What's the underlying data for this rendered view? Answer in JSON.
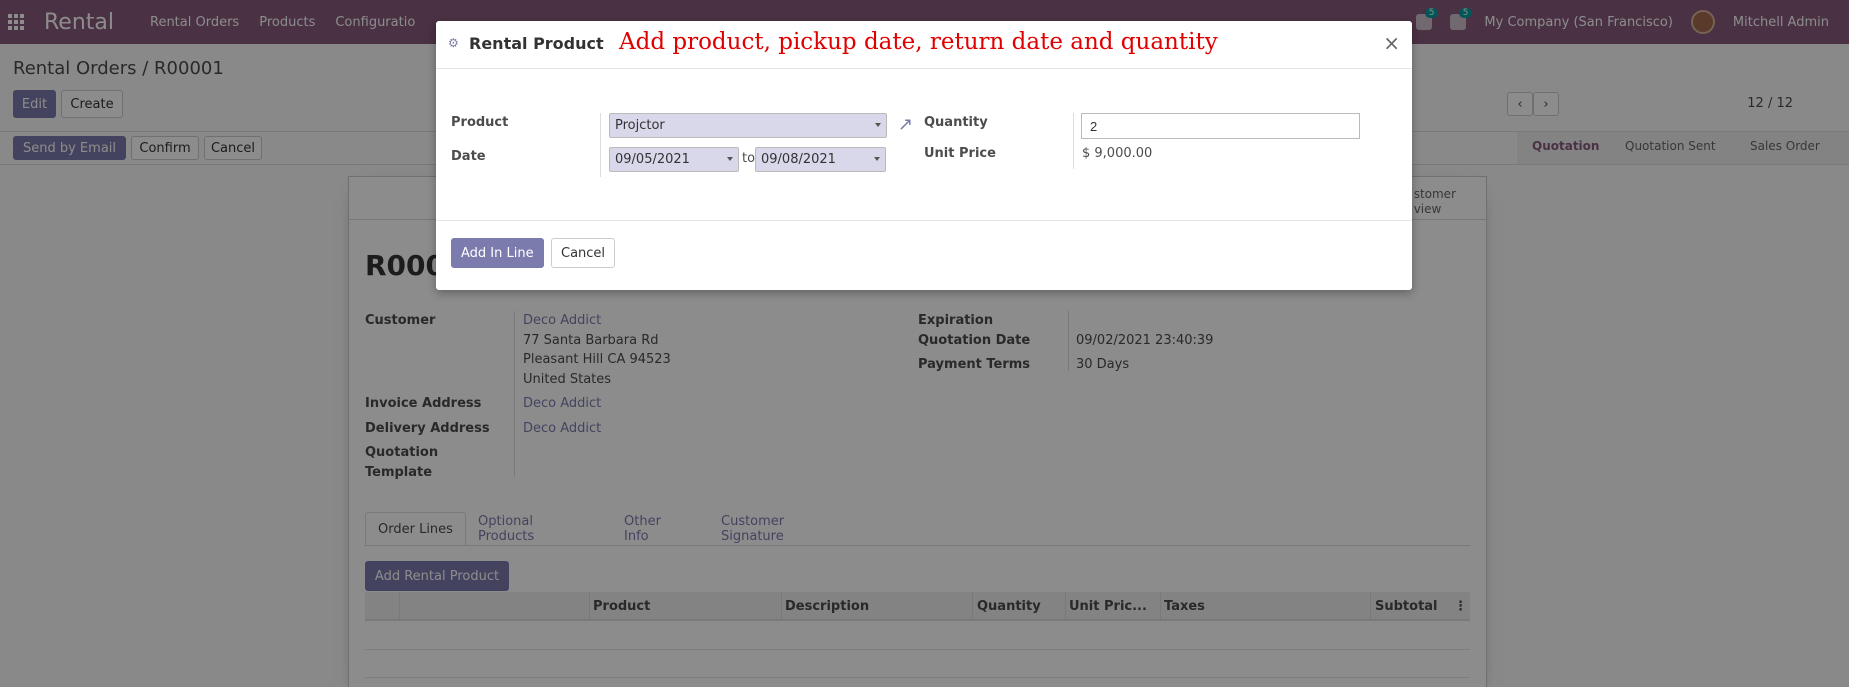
{
  "app": {
    "brand": "Rental"
  },
  "topnav": {
    "menus": [
      "Rental Orders",
      "Products",
      "Configuratio"
    ],
    "activity_count": "5",
    "message_count": "5",
    "company": "My Company (San Francisco)",
    "user": "Mitchell Admin"
  },
  "control": {
    "breadcrumb": "Rental Orders / R00001",
    "edit": "Edit",
    "create": "Create",
    "pager": "12 / 12"
  },
  "actions": {
    "send_email": "Send by Email",
    "confirm": "Confirm",
    "cancel": "Cancel"
  },
  "statusbar": {
    "stages": [
      "Quotation",
      "Quotation Sent",
      "Sales Order"
    ],
    "active": "Quotation"
  },
  "form": {
    "customer_preview": [
      "stomer",
      "view"
    ],
    "title": "R000",
    "customer_label": "Customer",
    "customer_name": "Deco Addict",
    "address": [
      "77 Santa Barbara Rd",
      "Pleasant Hill CA 94523",
      "United States"
    ],
    "invoice_label": "Invoice Address",
    "invoice_value": "Deco Addict",
    "delivery_label": "Delivery Address",
    "delivery_value": "Deco Addict",
    "template_label_1": "Quotation",
    "template_label_2": "Template",
    "expiration_label": "Expiration",
    "qdate_label": "Quotation Date",
    "qdate_value": "09/02/2021 23:40:39",
    "terms_label": "Payment Terms",
    "terms_value": "30 Days",
    "tabs": [
      "Order Lines",
      "Optional Products",
      "Other Info",
      "Customer Signature"
    ],
    "add_rental": "Add Rental Product",
    "columns": [
      "Product",
      "Description",
      "Quantity",
      "Unit Pric...",
      "Taxes",
      "Subtotal"
    ]
  },
  "modal": {
    "title": "Rental Product",
    "annotation": "Add product, pickup date, return date and quantity",
    "product_label": "Product",
    "product_value": "Projctor",
    "date_label": "Date",
    "date_from": "09/05/2021",
    "date_to_word": "to",
    "date_to": "09/08/2021",
    "quantity_label": "Quantity",
    "quantity_value": "2",
    "unit_price_label": "Unit Price",
    "unit_price_value": "$ 9,000.00",
    "add_button": "Add In Line",
    "cancel_button": "Cancel"
  }
}
